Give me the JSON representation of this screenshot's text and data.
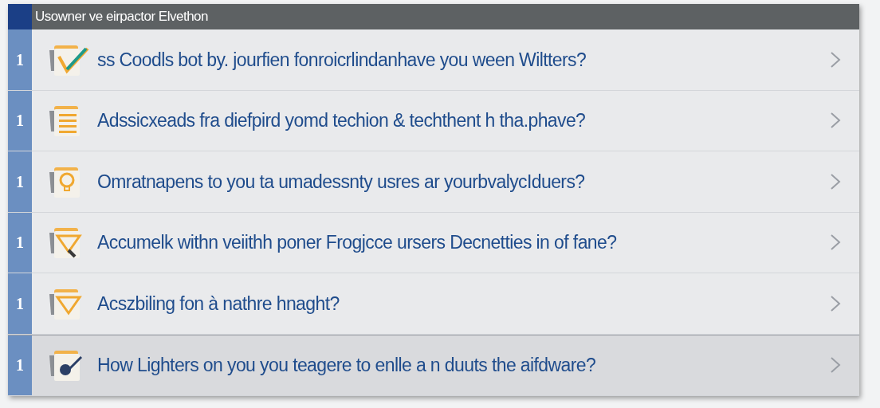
{
  "header": {
    "title": "Usowner ve eirpactor Elvethon"
  },
  "rows": [
    {
      "number": "1",
      "text": "ss Coodls bot by. jourfien fonroicrlindanhave you ween Wiltters?",
      "selected": false
    },
    {
      "number": "1",
      "text": "Adssicxeads fra diefpird yomd techion & techthent h tha.phave?",
      "selected": false
    },
    {
      "number": "1",
      "text": "Omratnapens to you ta umadessnty usres ar yourbvalycIduers?",
      "selected": false
    },
    {
      "number": "1",
      "text": "Accumelk withn veiithh poner Frogjcce ursers Decnetties in of fane?",
      "selected": false
    },
    {
      "number": "1",
      "text": "Acszbiling fon à nathre hnaght?",
      "selected": false
    },
    {
      "number": "1",
      "text": "How Lighters on you you teagere to enlle a n duuts the aifdware?",
      "selected": true
    }
  ]
}
